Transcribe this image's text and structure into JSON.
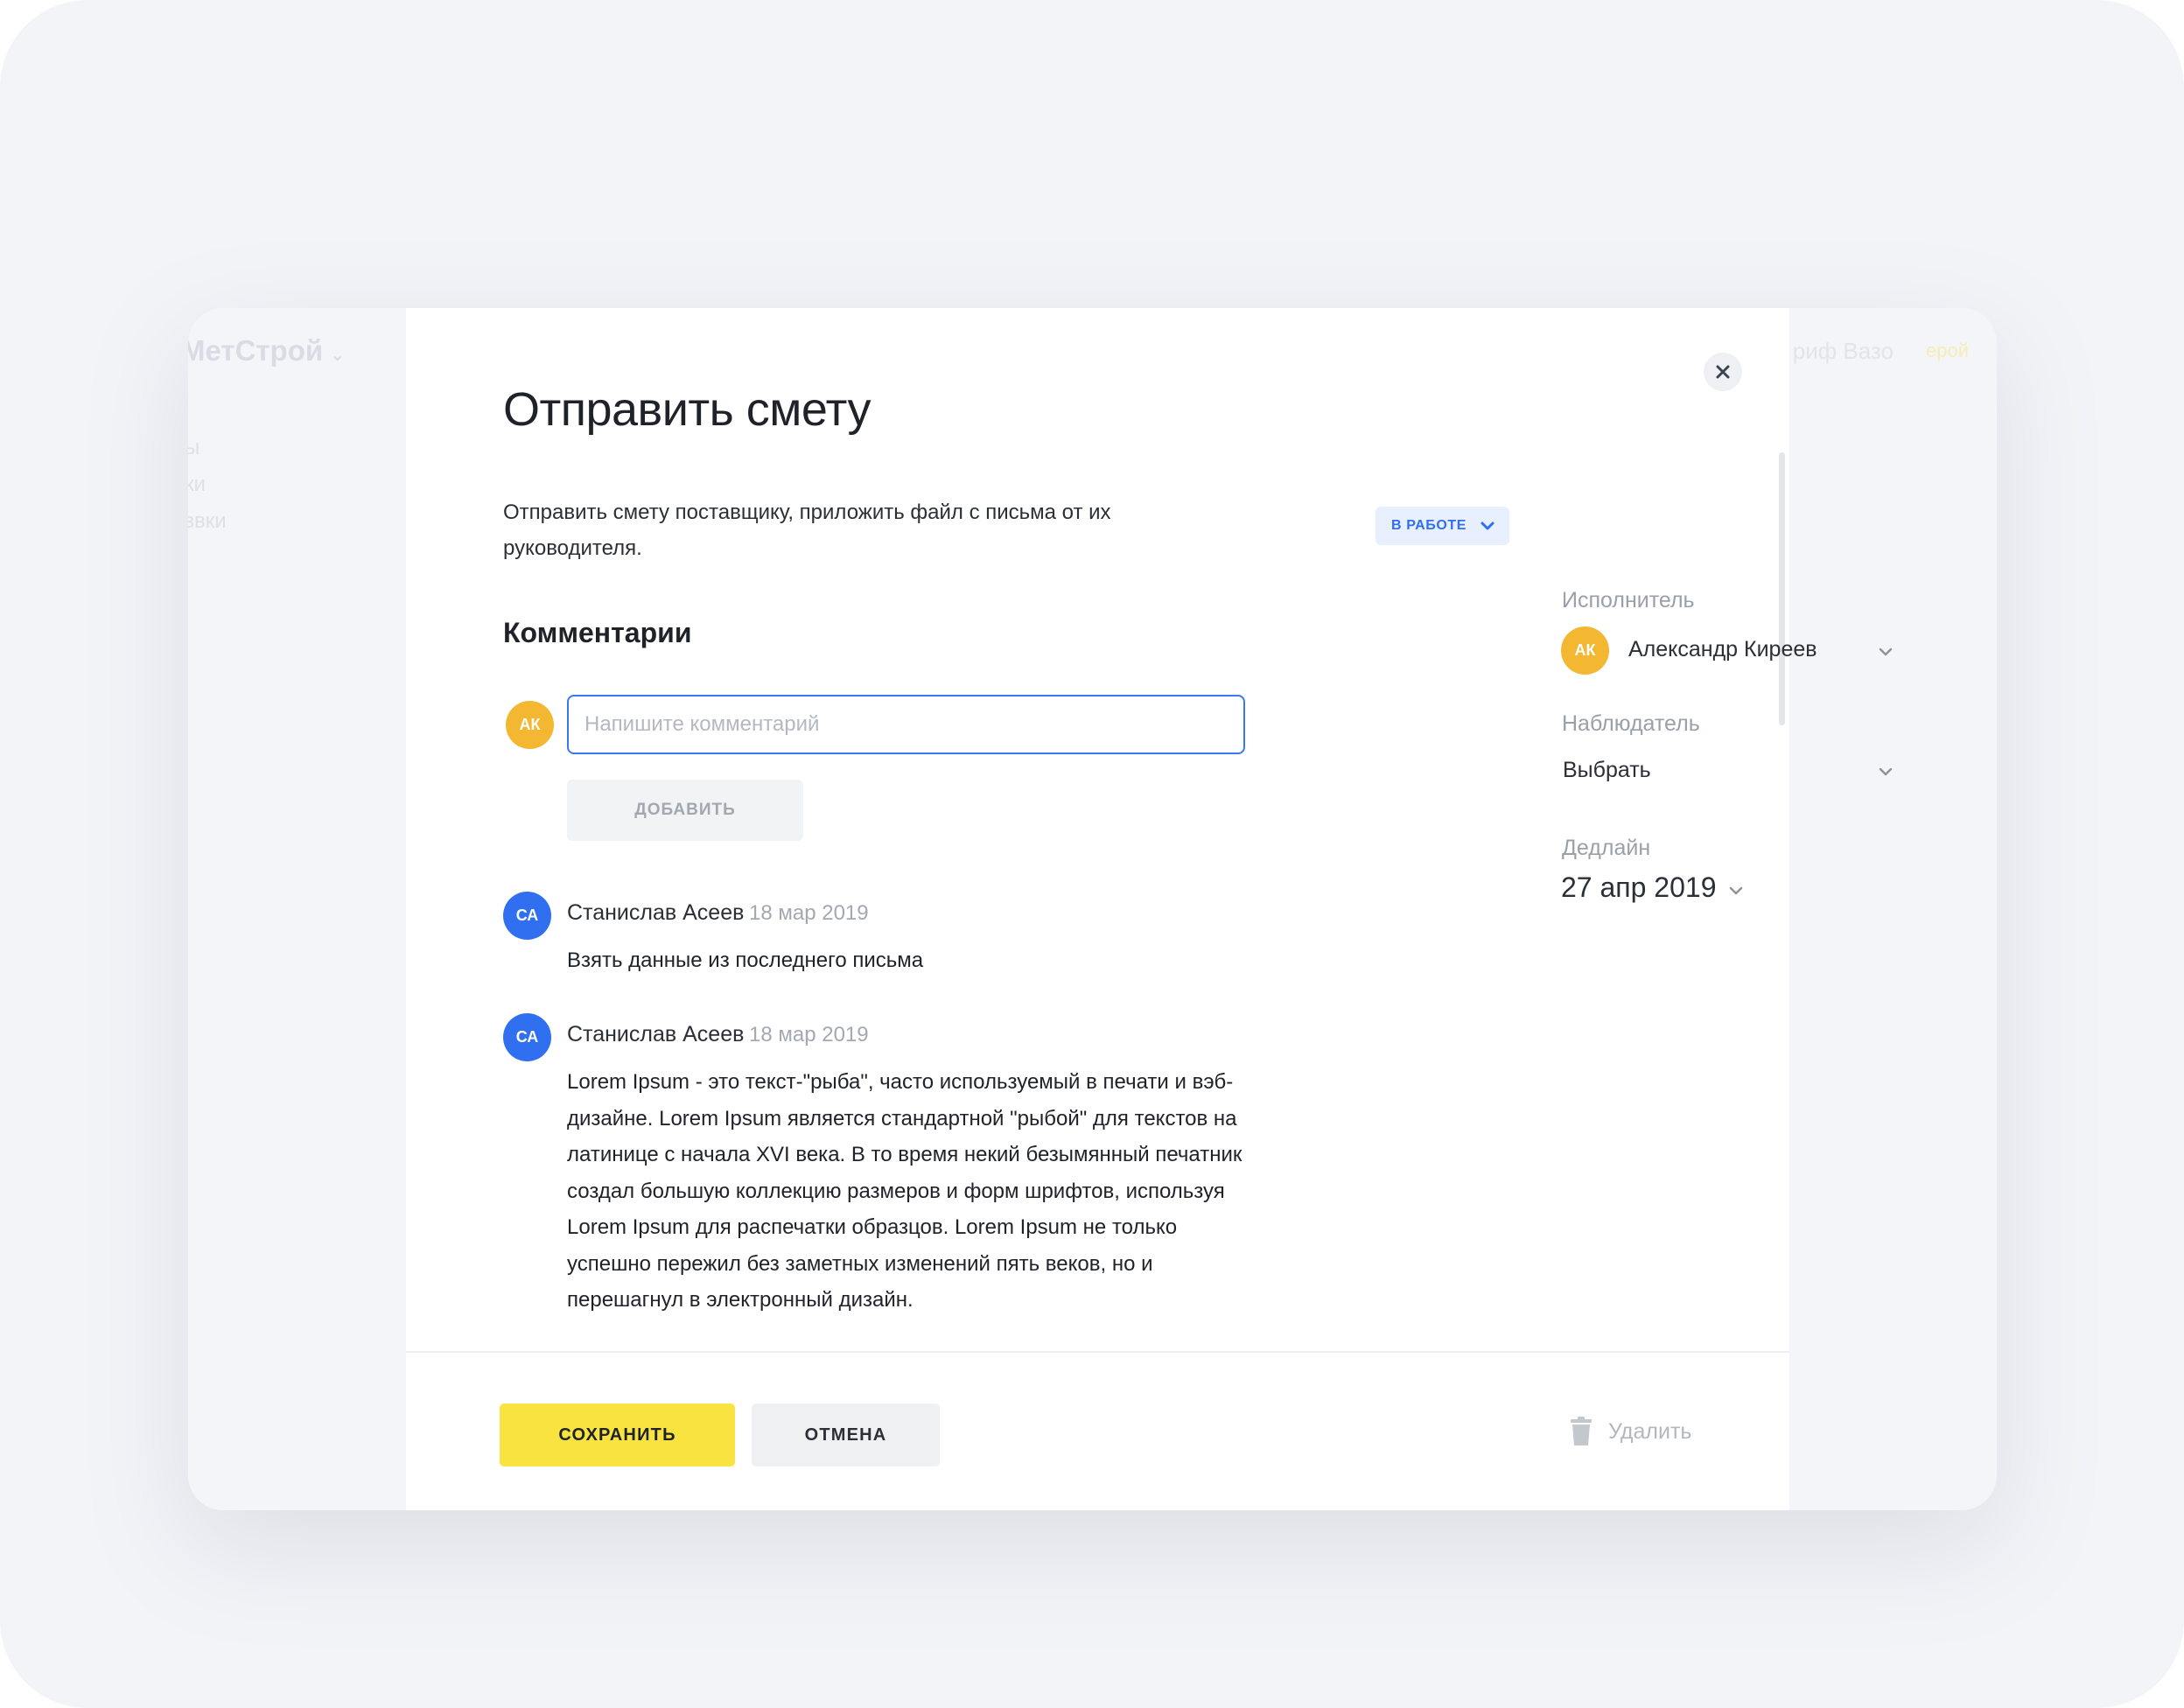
{
  "background_app": {
    "brand": "МетСтрой",
    "nav_items": [
      "ы",
      "ки",
      "звки"
    ],
    "user_name": "риф Вазо",
    "user_role": "ерой"
  },
  "modal": {
    "title": "Отправить смету",
    "description": "Отправить смету поставщику, приложить файл с письма от их руководителя.",
    "comments_heading": "Комментарии",
    "comment_input": {
      "placeholder": "Напишите комментарий",
      "value": ""
    },
    "add_button": "ДОБАВИТЬ",
    "current_user_initials": "АК",
    "comments": [
      {
        "initials": "СА",
        "author": "Станислав Асеев",
        "date": "18 мар 2019",
        "text": "Взять данные из последнего письма"
      },
      {
        "initials": "СА",
        "author": "Станислав Асеев",
        "date": "18 мар 2019",
        "text": "Lorem Ipsum - это текст-\"рыба\", часто используемый в печати и вэб-дизайне. Lorem Ipsum является стандартной \"рыбой\" для текстов на латинице с начала XVI века. В то время некий безымянный печатник создал большую коллекцию размеров и форм шрифтов, используя Lorem Ipsum для распечатки образцов. Lorem Ipsum не только успешно пережил без заметных изменений пять веков, но и перешагнул в электронный дизайн."
      }
    ],
    "sidebar": {
      "status": "В РАБОТЕ",
      "assignee_label": "Исполнитель",
      "assignee_initials": "АК",
      "assignee_name": "Александр Киреев",
      "observer_label": "Наблюдатель",
      "observer_value": "Выбрать",
      "deadline_label": "Дедлайн",
      "deadline_value": "27 апр 2019"
    },
    "footer": {
      "save_label": "СОХРАНИТЬ",
      "cancel_label": "ОТМЕНА",
      "delete_label": "Удалить"
    }
  },
  "icons": [
    "close-icon",
    "chevron-down-icon",
    "trash-icon"
  ],
  "colors": {
    "accent_blue": "#2f6ff0",
    "save_yellow": "#f8e340",
    "avatar_yellow": "#f3b731",
    "page_background": "#f3f4f8"
  }
}
